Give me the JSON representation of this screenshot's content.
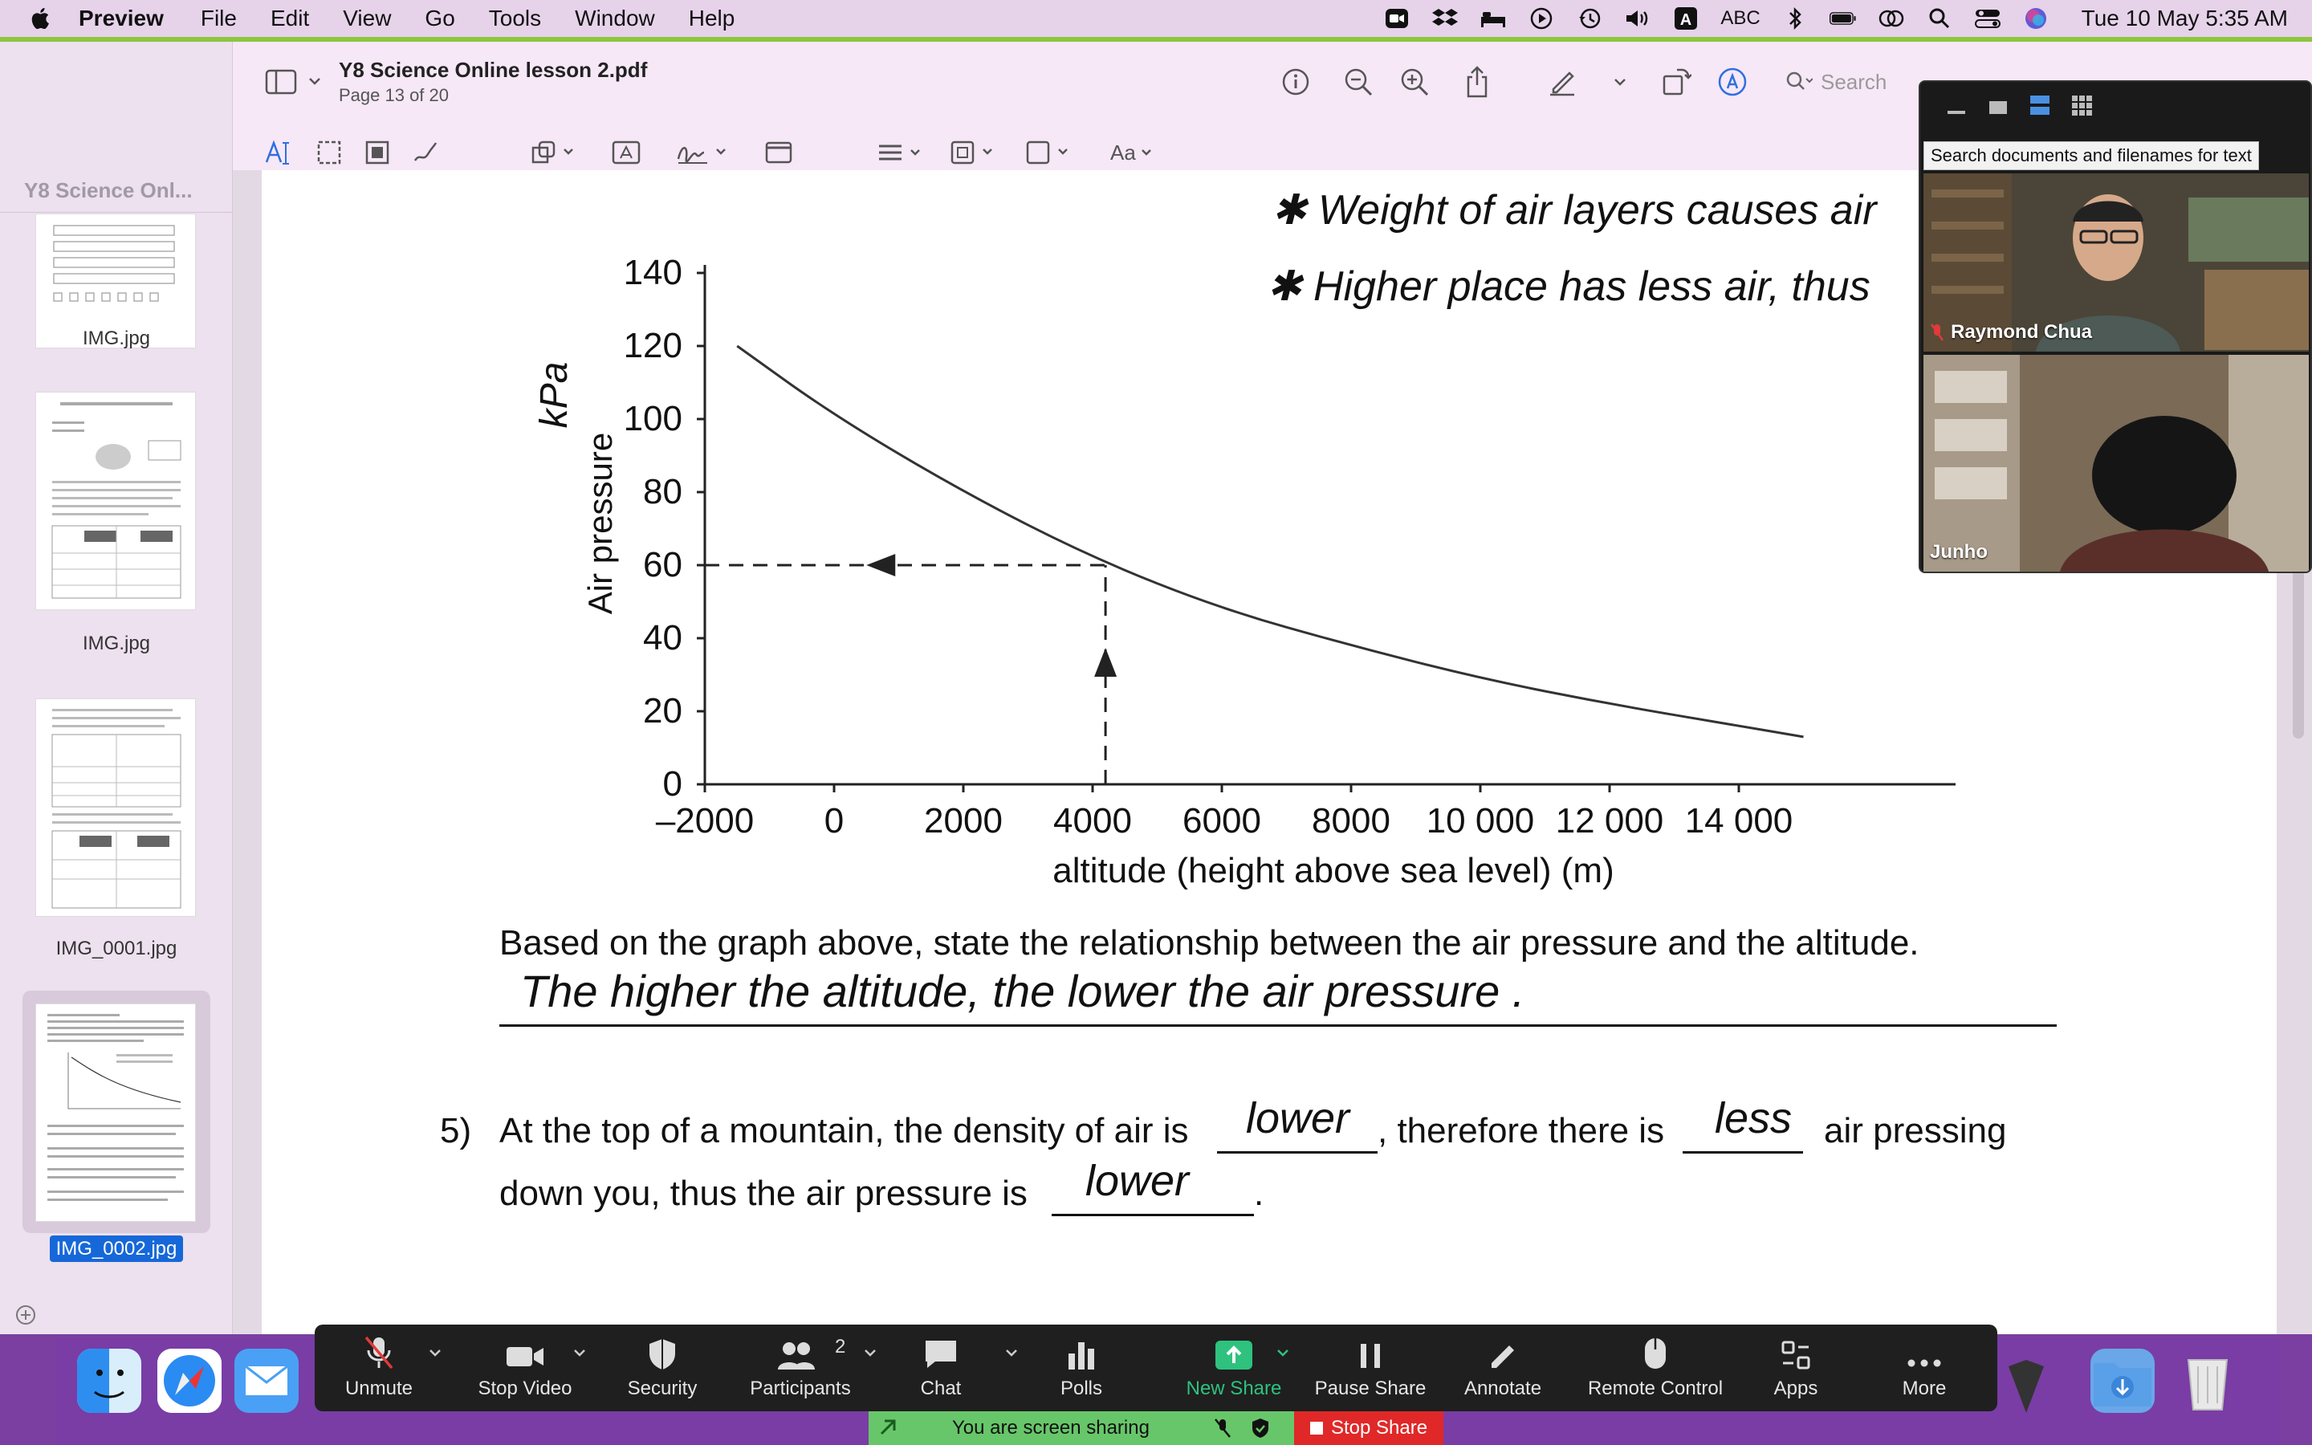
{
  "menubar": {
    "app": "Preview",
    "items": [
      "File",
      "Edit",
      "View",
      "Go",
      "Tools",
      "Window",
      "Help"
    ],
    "status_abc": "ABC",
    "clock": "Tue 10 May  5:35 AM"
  },
  "document": {
    "title": "Y8 Science Online lesson 2.pdf",
    "page": "Page 13 of 20",
    "search_placeholder": "Search"
  },
  "sidebar": {
    "title": "Y8 Science Onl...",
    "thumbnails": [
      "IMG.jpg",
      "IMG.jpg",
      "IMG_0001.jpg",
      "IMG_0002.jpg"
    ],
    "selected_index": 3
  },
  "chart_data": {
    "type": "line",
    "xlabel": "altitude (height above sea level) (m)",
    "ylabel": "Air pressure",
    "ylabel_handwritten": "kPa",
    "xlim": [
      -2000,
      15000
    ],
    "ylim": [
      0,
      140
    ],
    "xticks": [
      "–2000",
      "0",
      "2000",
      "4000",
      "6000",
      "8000",
      "10 000",
      "12 000",
      "14 000"
    ],
    "yticks": [
      "0",
      "20",
      "40",
      "60",
      "80",
      "100",
      "120",
      "140"
    ],
    "series": [
      {
        "x": [
          -1500,
          0,
          2000,
          4000,
          6000,
          8000,
          10000,
          12000,
          14000,
          15000
        ],
        "y": [
          120,
          101,
          80,
          62,
          48,
          38,
          29,
          22,
          16,
          13
        ]
      }
    ],
    "annotations": {
      "read_x": 4200,
      "read_y": 60
    }
  },
  "notes": {
    "line1": "Weight of air layers causes air",
    "line2": "Higher place has less air, thus"
  },
  "question4": {
    "prompt": "Based on the graph above, state the relationship between the air pressure and the altitude.",
    "answer": "The higher the altitude, the lower the air pressure ."
  },
  "question5": {
    "number": "5)",
    "part1": "At the top of a mountain, the density of air is",
    "blank1": "lower",
    "part2": ", therefore there is",
    "blank2": "less",
    "part3": "air pressing",
    "part4": "down you, thus the air pressure is",
    "blank3": "lower",
    "part5": "."
  },
  "video": {
    "tooltip": "Search documents and filenames for text",
    "participant1": "Raymond Chua",
    "participant2": "Junho"
  },
  "zoom": {
    "buttons": [
      "Unmute",
      "Stop Video",
      "Security",
      "Participants",
      "Chat",
      "Polls",
      "New Share",
      "Pause Share",
      "Annotate",
      "Remote Control",
      "Apps",
      "More"
    ],
    "participants_count": "2",
    "sharing_text": "You are screen sharing",
    "stop_share": "Stop Share",
    "accent": "#2ec27e",
    "stop_color": "#e02828"
  }
}
